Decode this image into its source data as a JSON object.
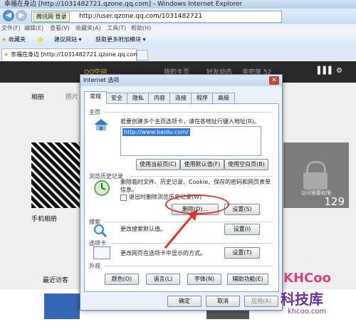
{
  "window": {
    "title": "幸福在身边 [http://1031482721.qzone.qq.com] - Windows Internet Explorer",
    "address_tag": "腾讯网 登录",
    "url": "http://user.qzone.qq.com/1031482721",
    "menu": [
      "文件(F)",
      "编辑(E)",
      "查看(V)",
      "收藏夹(A)",
      "工具(T)",
      "帮助(H)"
    ],
    "favorites": {
      "label": "收藏夹",
      "item1": "建议网站 ▾",
      "item2": "获取更多附加模块 ▾"
    },
    "tab_title": "幸福在身边 [http://1031482721.qzone.qq.com]"
  },
  "qzone": {
    "logo": "QQ空间",
    "nav": [
      "我的主页",
      "好友动态",
      "亲密度 52"
    ],
    "tabs": [
      "相册",
      "照片"
    ],
    "albums": [
      {
        "label": "手机相册"
      },
      {
        "label": "访问需要权限",
        "count": "129"
      }
    ],
    "recent_visitors": "最近访客"
  },
  "dialog": {
    "title": "Internet 选项",
    "tabs": [
      "常规",
      "安全",
      "隐私",
      "内容",
      "连接",
      "程序",
      "高级"
    ],
    "home": {
      "group": "主页",
      "desc": "若要创建多个主页选项卡，请在各地址行键入地址(R)。",
      "url": "http://www.baidu.com/",
      "btn_current": "使用当前页(C)",
      "btn_default": "使用默认值(F)",
      "btn_blank": "使用空白页(B)"
    },
    "history": {
      "group": "浏览历史记录",
      "desc": "删除临时文件、历史记录、Cookie、保存的密码和网页表单信息。",
      "checkbox": "退出时删除浏览历史记录(W)",
      "btn_delete": "删除(D)...",
      "btn_settings": "设置(S)"
    },
    "search": {
      "group": "搜索",
      "desc": "更改搜索默认值。",
      "btn_settings": "设置(I)"
    },
    "tabs_group": {
      "group": "选项卡",
      "desc": "更改网页在选项卡中显示的方式。",
      "btn_settings": "设置(T)"
    },
    "appearance": {
      "group": "外观",
      "btn_colors": "颜色(O)",
      "btn_languages": "语言(L)",
      "btn_fonts": "字体(N)",
      "btn_accessibility": "辅助功能(E)"
    },
    "footer": {
      "ok": "确定",
      "cancel": "取消",
      "apply": "应用(A)"
    }
  },
  "watermark": {
    "brand": "KHCoo",
    "cn": "科技库",
    "site": "khcoo.com"
  }
}
